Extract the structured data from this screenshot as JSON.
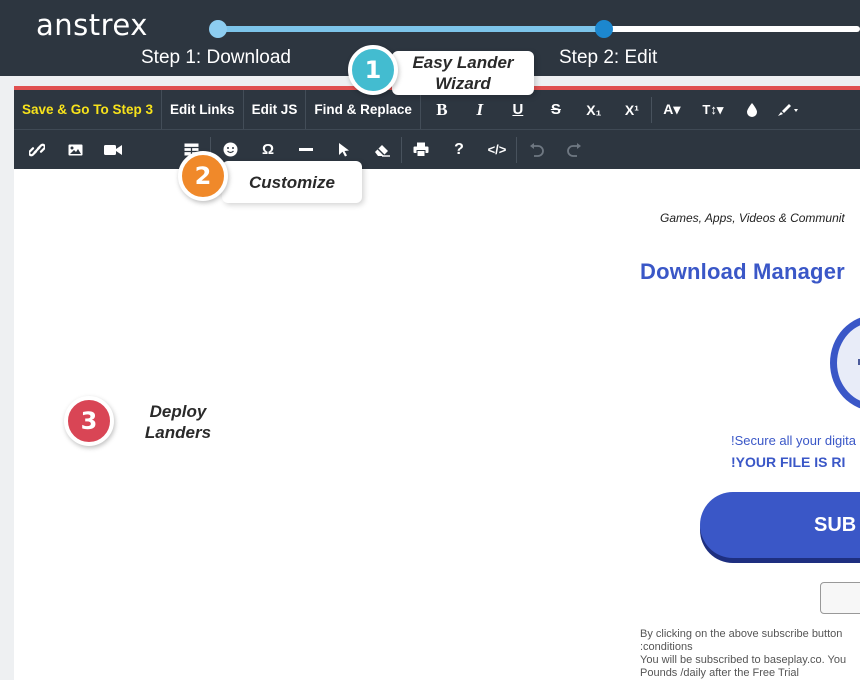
{
  "app": {
    "logo_text": "anstrex"
  },
  "wizard": {
    "step1_label": "Step 1: Download",
    "step2_label": "Step 2: Edit",
    "progress_fraction": 0.6
  },
  "toolbar": {
    "row1": {
      "save_label": "Save & Go To Step 3",
      "edit_links_label": "Edit Links",
      "edit_js_label": "Edit JS",
      "find_replace_label": "Find & Replace",
      "bold": "B",
      "italic": "I",
      "underline": "U",
      "strikethrough": "S",
      "subscript": "X₁",
      "superscript": "X¹",
      "font_color": "A▾",
      "font_size": "T↕▾"
    },
    "row2_icons": [
      "link-icon",
      "image-icon",
      "video-icon",
      "table-icon",
      "emoji-icon",
      "special-char-icon",
      "horizontal-line-icon",
      "select-icon",
      "eraser-icon",
      "print-icon",
      "help-icon",
      "code-view-icon",
      "undo-icon",
      "redo-icon"
    ],
    "special_char": "Ω",
    "help": "?",
    "code_view": "</>"
  },
  "callouts": {
    "c1_number": "1",
    "c1_line1": "Easy Lander",
    "c1_line2": "Wizard",
    "c2_number": "2",
    "c2_text": "Customize",
    "c3_number": "3",
    "c3_line1": "Deploy",
    "c3_line2": "Landers"
  },
  "lander": {
    "tagline": "Games, Apps, Videos & Communit",
    "title": "Download Manager",
    "secure_text": "!Secure all your digita",
    "file_ready_text": "!YOUR FILE IS RI",
    "subscribe_label": "SUB",
    "terms_line1": "By clicking on the above subscribe button",
    "terms_line2": ":conditions",
    "terms_line3": "You will be subscribed to baseplay.co. You",
    "terms_line4": "Pounds /daily after the Free Trial"
  },
  "colors": {
    "header_bg": "#2d3640",
    "accent_yellow": "#f7e21b",
    "progress_fill": "#7cc4ea",
    "progress_active_dot": "#1c87cf",
    "lander_blue": "#3a57c7",
    "badge1": "#43bcd0",
    "badge2": "#f0892a",
    "badge3": "#d94555",
    "red_line": "#e05050"
  }
}
